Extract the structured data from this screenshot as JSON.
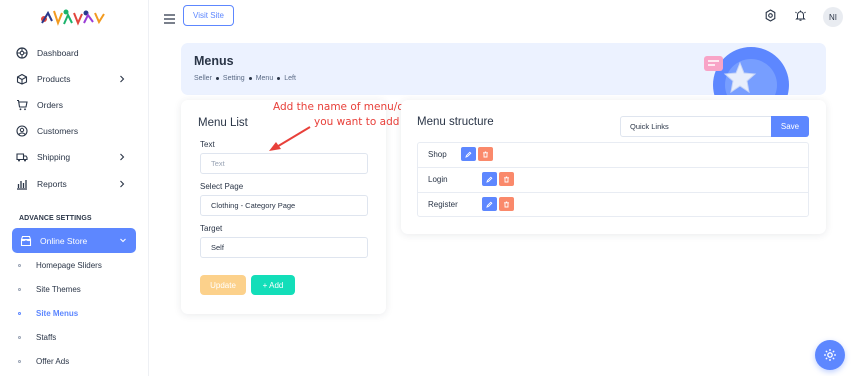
{
  "header": {
    "visit_site_label": "Visit Site",
    "avatar_initials": "NI"
  },
  "sidebar": {
    "items": [
      {
        "label": "Dashboard",
        "icon": "dashboard-icon"
      },
      {
        "label": "Products",
        "icon": "box-icon"
      },
      {
        "label": "Orders",
        "icon": "cart-icon"
      },
      {
        "label": "Customers",
        "icon": "user-icon"
      },
      {
        "label": "Shipping",
        "icon": "truck-icon"
      },
      {
        "label": "Reports",
        "icon": "chart-icon"
      }
    ],
    "section_title": "ADVANCE SETTINGS",
    "active_group": {
      "label": "Online Store",
      "icon": "store-icon"
    },
    "sub_items": [
      {
        "label": "Homepage Sliders"
      },
      {
        "label": "Site Themes"
      },
      {
        "label": "Site Menus"
      },
      {
        "label": "Staffs"
      },
      {
        "label": "Offer Ads"
      }
    ]
  },
  "banner": {
    "title": "Menus",
    "breadcrumb": [
      "Seller",
      "Setting",
      "Menu",
      "Left"
    ]
  },
  "menu_list": {
    "title": "Menu List",
    "text_label": "Text",
    "text_placeholder": "Text",
    "select_page_label": "Select Page",
    "select_page_value": "Clothing - Category Page",
    "target_label": "Target",
    "target_value": "Self",
    "update_label": "Update",
    "add_label": "+ Add"
  },
  "annotation": {
    "line1": "Add the name of menu/options",
    "line2": "you want to add"
  },
  "menu_structure": {
    "title": "Menu structure",
    "quick_links_value": "Quick Links",
    "save_label": "Save",
    "rows": [
      {
        "label": "Shop"
      },
      {
        "label": "Login"
      },
      {
        "label": "Register"
      }
    ]
  },
  "colors": {
    "primary": "#5d87ff",
    "warning": "#fcd18b",
    "success": "#13deb9",
    "danger": "#fa896b",
    "annotation": "#e8403a"
  }
}
